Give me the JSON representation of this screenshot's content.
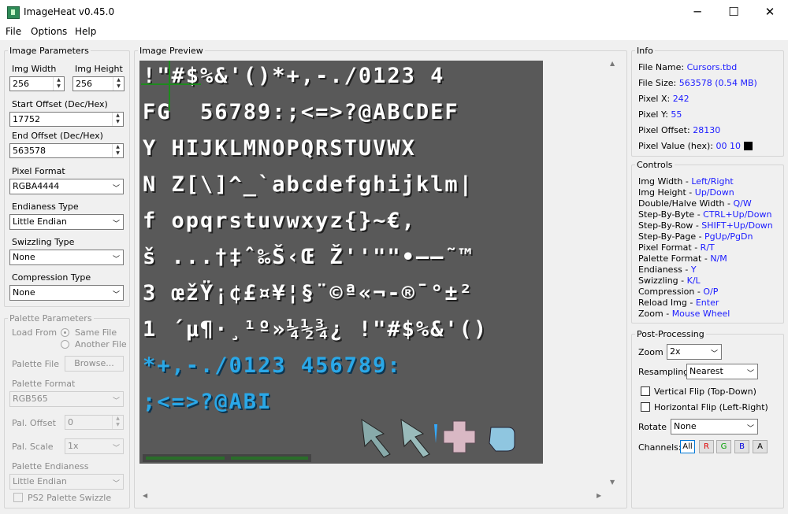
{
  "window": {
    "title": "ImageHeat v0.45.0",
    "min": "─",
    "max": "☐",
    "close": "✕"
  },
  "menu": [
    "File",
    "Options",
    "Help"
  ],
  "image_params": {
    "legend": "Image Parameters",
    "img_width_label": "Img Width",
    "img_width": "256",
    "img_height_label": "Img Height",
    "img_height": "256",
    "start_offset_label": "Start Offset (Dec/Hex)",
    "start_offset": "17752",
    "end_offset_label": "End Offset (Dec/Hex)",
    "end_offset": "563578",
    "pixel_format_label": "Pixel Format",
    "pixel_format": "RGBA4444",
    "endianess_label": "Endianess Type",
    "endianess": "Little Endian",
    "swizzling_label": "Swizzling Type",
    "swizzling": "None",
    "compression_label": "Compression Type",
    "compression": "None"
  },
  "palette": {
    "legend": "Palette Parameters",
    "load_from_label": "Load From",
    "same_file": "Same File",
    "another_file": "Another File",
    "palette_file_label": "Palette File",
    "browse": "Browse...",
    "palette_format_label": "Palette Format",
    "palette_format": "RGB565",
    "pal_offset_label": "Pal. Offset",
    "pal_offset": "0",
    "pal_scale_label": "Pal. Scale",
    "pal_scale": "1x",
    "palette_endianess_label": "Palette Endianess",
    "palette_endianess": "Little Endian",
    "ps2_swizzle": "PS2 Palette Swizzle"
  },
  "preview": {
    "legend": "Image Preview",
    "lines": [
      {
        "text": "!\"#$%&'()*+,-./0123 4",
        "cyan": false
      },
      {
        "text": "FG  56789:;<=>?@ABCDEF",
        "cyan": false
      },
      {
        "text": "Y HIJKLMNOPQRSTUVWX",
        "cyan": false
      },
      {
        "text": "N Z[\\]^_`abcdefghijklm|",
        "cyan": false
      },
      {
        "text": "f opqrstuvwxyz{}~€,",
        "cyan": false
      },
      {
        "text": "š ...†‡ˆ‰Š‹Œ Ž''\"\"•–—˜™",
        "cyan": false
      },
      {
        "text": "3 œžŸ¡¢£¤¥¦§¨©ª«¬-®¯°±²",
        "cyan": false
      },
      {
        "text": "1 ´µ¶·¸¹º»¼½¾¿ !\"#$%&'()",
        "cyan": false
      },
      {
        "text": "*+,-./0123 456789:",
        "cyan": true
      },
      {
        "text": ";<=>?@ABI",
        "cyan": true
      }
    ]
  },
  "info": {
    "legend": "Info",
    "file_name_label": "File Name:",
    "file_name": "Cursors.tbd",
    "file_size_label": "File Size:",
    "file_size": "563578 (0.54 MB)",
    "pixel_x_label": "Pixel X:",
    "pixel_x": "242",
    "pixel_y_label": "Pixel Y:",
    "pixel_y": "55",
    "pixel_offset_label": "Pixel Offset:",
    "pixel_offset": "28130",
    "pixel_value_label": "Pixel Value (hex):",
    "pixel_value": "00 10",
    "pixel_value_color": "#000000"
  },
  "controls": {
    "legend": "Controls",
    "rows": [
      {
        "label": "Img Width - ",
        "keys": "Left/Right"
      },
      {
        "label": "Img Height - ",
        "keys": "Up/Down"
      },
      {
        "label": "Double/Halve Width - ",
        "keys": "Q/W"
      },
      {
        "label": "Step-By-Byte - ",
        "keys": "CTRL+Up/Down"
      },
      {
        "label": "Step-By-Row - ",
        "keys": "SHIFT+Up/Down"
      },
      {
        "label": "Step-By-Page - ",
        "keys": "PgUp/PgDn"
      },
      {
        "label": "Pixel Format - ",
        "keys": "R/T"
      },
      {
        "label": "Palette Format - ",
        "keys": "N/M"
      },
      {
        "label": "Endianess - ",
        "keys": "Y"
      },
      {
        "label": "Swizzling - ",
        "keys": "K/L"
      },
      {
        "label": "Compression - ",
        "keys": "O/P"
      },
      {
        "label": "Reload Img - ",
        "keys": "Enter"
      },
      {
        "label": "Zoom - ",
        "keys": "Mouse Wheel"
      }
    ]
  },
  "post": {
    "legend": "Post-Processing",
    "zoom_label": "Zoom",
    "zoom": "2x",
    "resampling_label": "Resampling",
    "resampling": "Nearest",
    "vflip": "Vertical Flip (Top-Down)",
    "hflip": "Horizontal Flip (Left-Right)",
    "rotate_label": "Rotate",
    "rotate": "None",
    "channels_label": "Channels:",
    "channels": [
      {
        "label": "All",
        "color": "#000000"
      },
      {
        "label": "R",
        "color": "#e00000"
      },
      {
        "label": "G",
        "color": "#00a000"
      },
      {
        "label": "B",
        "color": "#0000e0"
      },
      {
        "label": "A",
        "color": "#000000"
      }
    ]
  }
}
